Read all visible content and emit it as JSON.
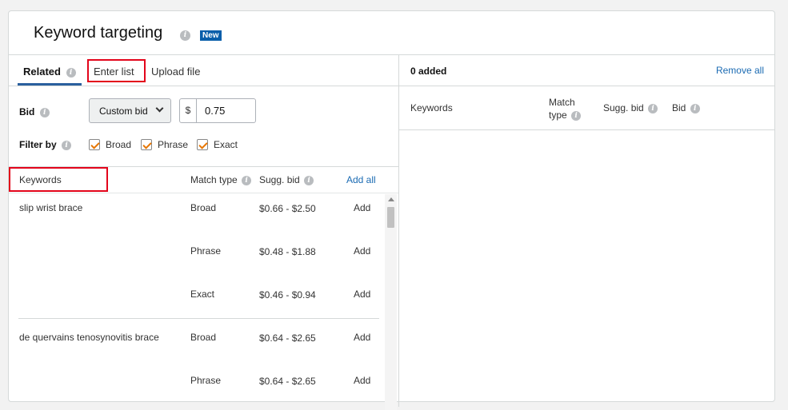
{
  "header": {
    "title": "Keyword targeting",
    "badge": "New"
  },
  "tabs": [
    {
      "label": "Related",
      "active": true
    },
    {
      "label": "Enter list",
      "active": false
    },
    {
      "label": "Upload file",
      "active": false
    }
  ],
  "bid": {
    "label": "Bid",
    "select_value": "Custom bid",
    "currency": "$",
    "value": "0.75"
  },
  "filter": {
    "label": "Filter by",
    "options": [
      {
        "label": "Broad",
        "checked": true
      },
      {
        "label": "Phrase",
        "checked": true
      },
      {
        "label": "Exact",
        "checked": true
      }
    ]
  },
  "columns": {
    "keywords": "Keywords",
    "match_type": "Match type",
    "sugg_bid": "Sugg. bid",
    "add_all": "Add all"
  },
  "rows": [
    {
      "keyword": "slip wrist brace",
      "match": "Broad",
      "range": "$0.66 - $2.50",
      "action": "Add"
    },
    {
      "keyword": "",
      "match": "Phrase",
      "range": "$0.48 - $1.88",
      "action": "Add"
    },
    {
      "keyword": "",
      "match": "Exact",
      "range": "$0.46 - $0.94",
      "action": "Add"
    },
    {
      "keyword": "de quervains tenosynovitis brace",
      "match": "Broad",
      "range": "$0.64 - $2.65",
      "action": "Add"
    },
    {
      "keyword": "",
      "match": "Phrase",
      "range": "$0.64 - $2.65",
      "action": "Add"
    }
  ],
  "right": {
    "added": "0 added",
    "remove_all": "Remove all",
    "columns": {
      "keywords": "Keywords",
      "match_line1": "Match",
      "match_line2": "type",
      "sugg_bid": "Sugg. bid",
      "bid": "Bid"
    }
  },
  "colors": {
    "link": "#1b6bb3",
    "highlight": "#e3051b",
    "badge": "#0a5eaa",
    "checkbox_check": "#e77600"
  }
}
